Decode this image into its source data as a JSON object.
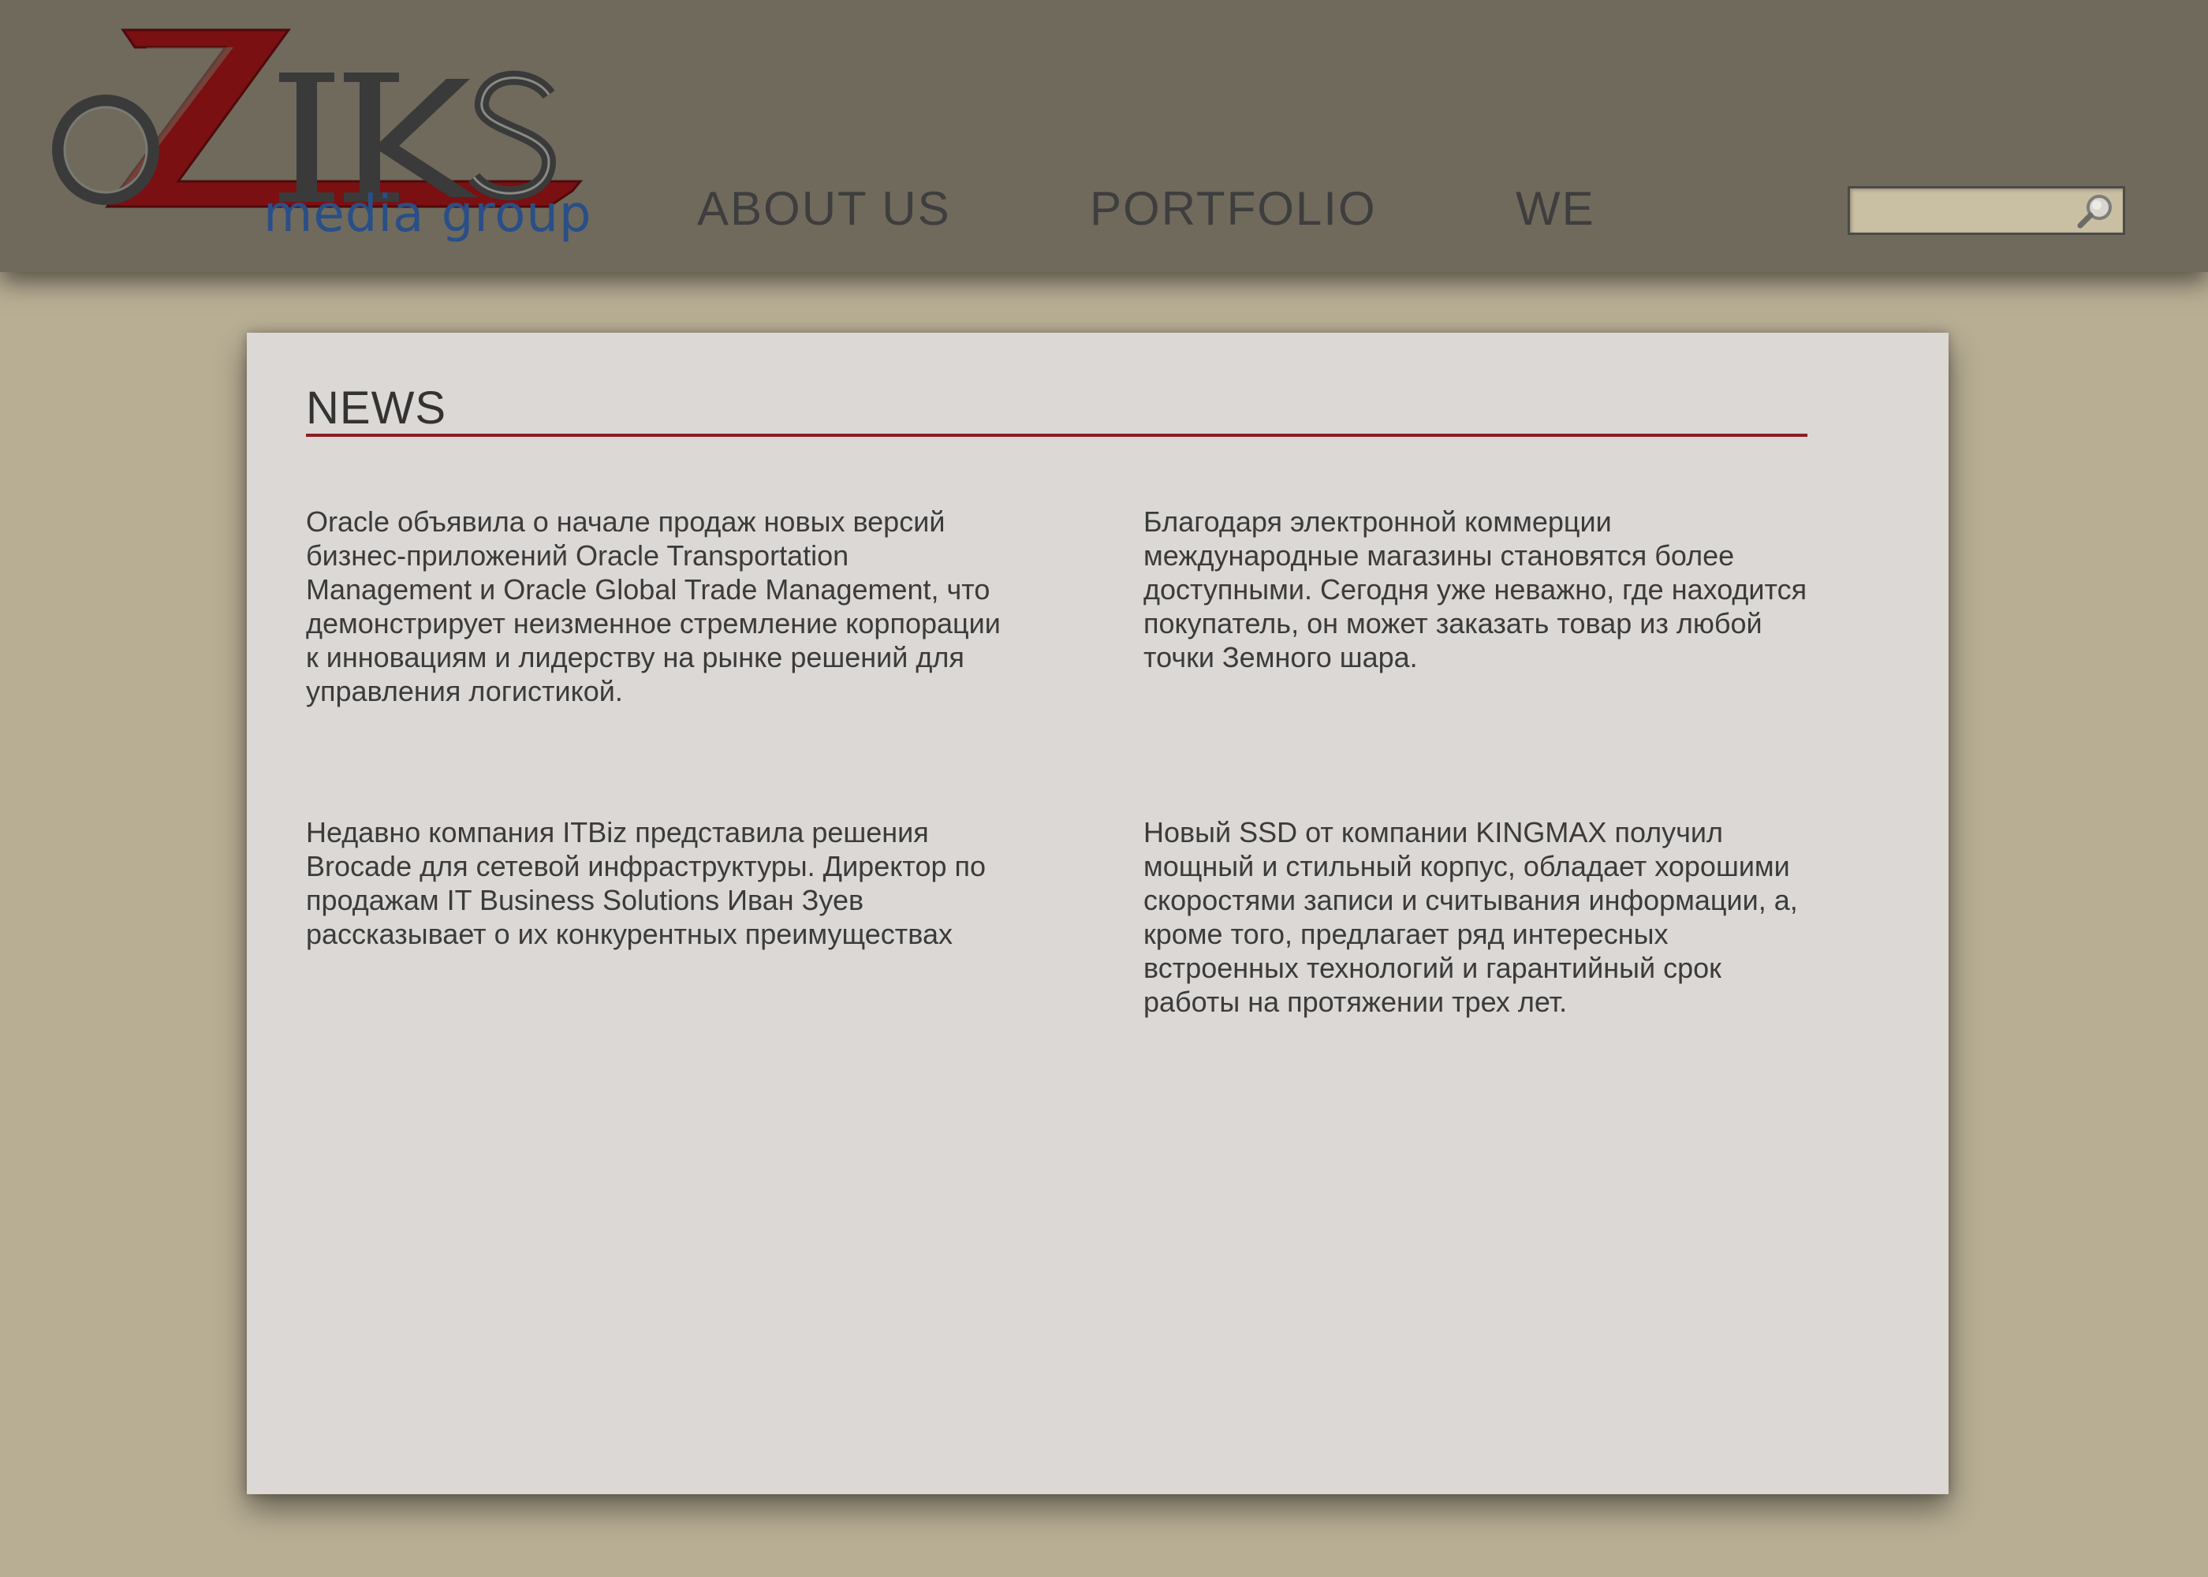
{
  "header": {
    "logo": {
      "wordmark": "OZIKS",
      "subtitle": "media group"
    },
    "nav": [
      {
        "label": "ABOUT US"
      },
      {
        "label": "PORTFOLIO"
      },
      {
        "label": "WE"
      }
    ],
    "search": {
      "value": "",
      "placeholder": "",
      "icon": "search-icon"
    }
  },
  "news": {
    "title": "NEWS",
    "items": [
      {
        "text": "Oracle объявила о начале продаж новых версий бизнес-приложений Oracle Transportation Management и Oracle Global Trade Management, что демонстрирует неизменное стремление корпорации к инновациям и лидерству на рынке решений для управления логистикой."
      },
      {
        "text": "Благодаря электронной коммерции международные магазины становятся более доступными. Сегодня уже неважно, где находится покупатель, он может заказать товар из любой точки Земного шара."
      },
      {
        "text": "Недавно компания ITBiz представила решения Brocade для сетевой инфраструктуры. Директор по продажам IT Business Solutions Иван Зуев рассказывает о их конкурентных преимуществах"
      },
      {
        "text": "Новый SSD от компании KINGMAX получил мощный и стильный корпус, обладает хорошими скоростями записи и считывания информации, а, кроме того, предлагает ряд интересных встроенных технологий и гарантийный срок работы на протяжении трех лет."
      }
    ]
  },
  "colors": {
    "page_background": "#b8ae94",
    "header_background": "#6f6a5c",
    "card_background": "#dbd8d5",
    "accent_red": "#8c1c20",
    "logo_blue": "#2a4f86"
  }
}
